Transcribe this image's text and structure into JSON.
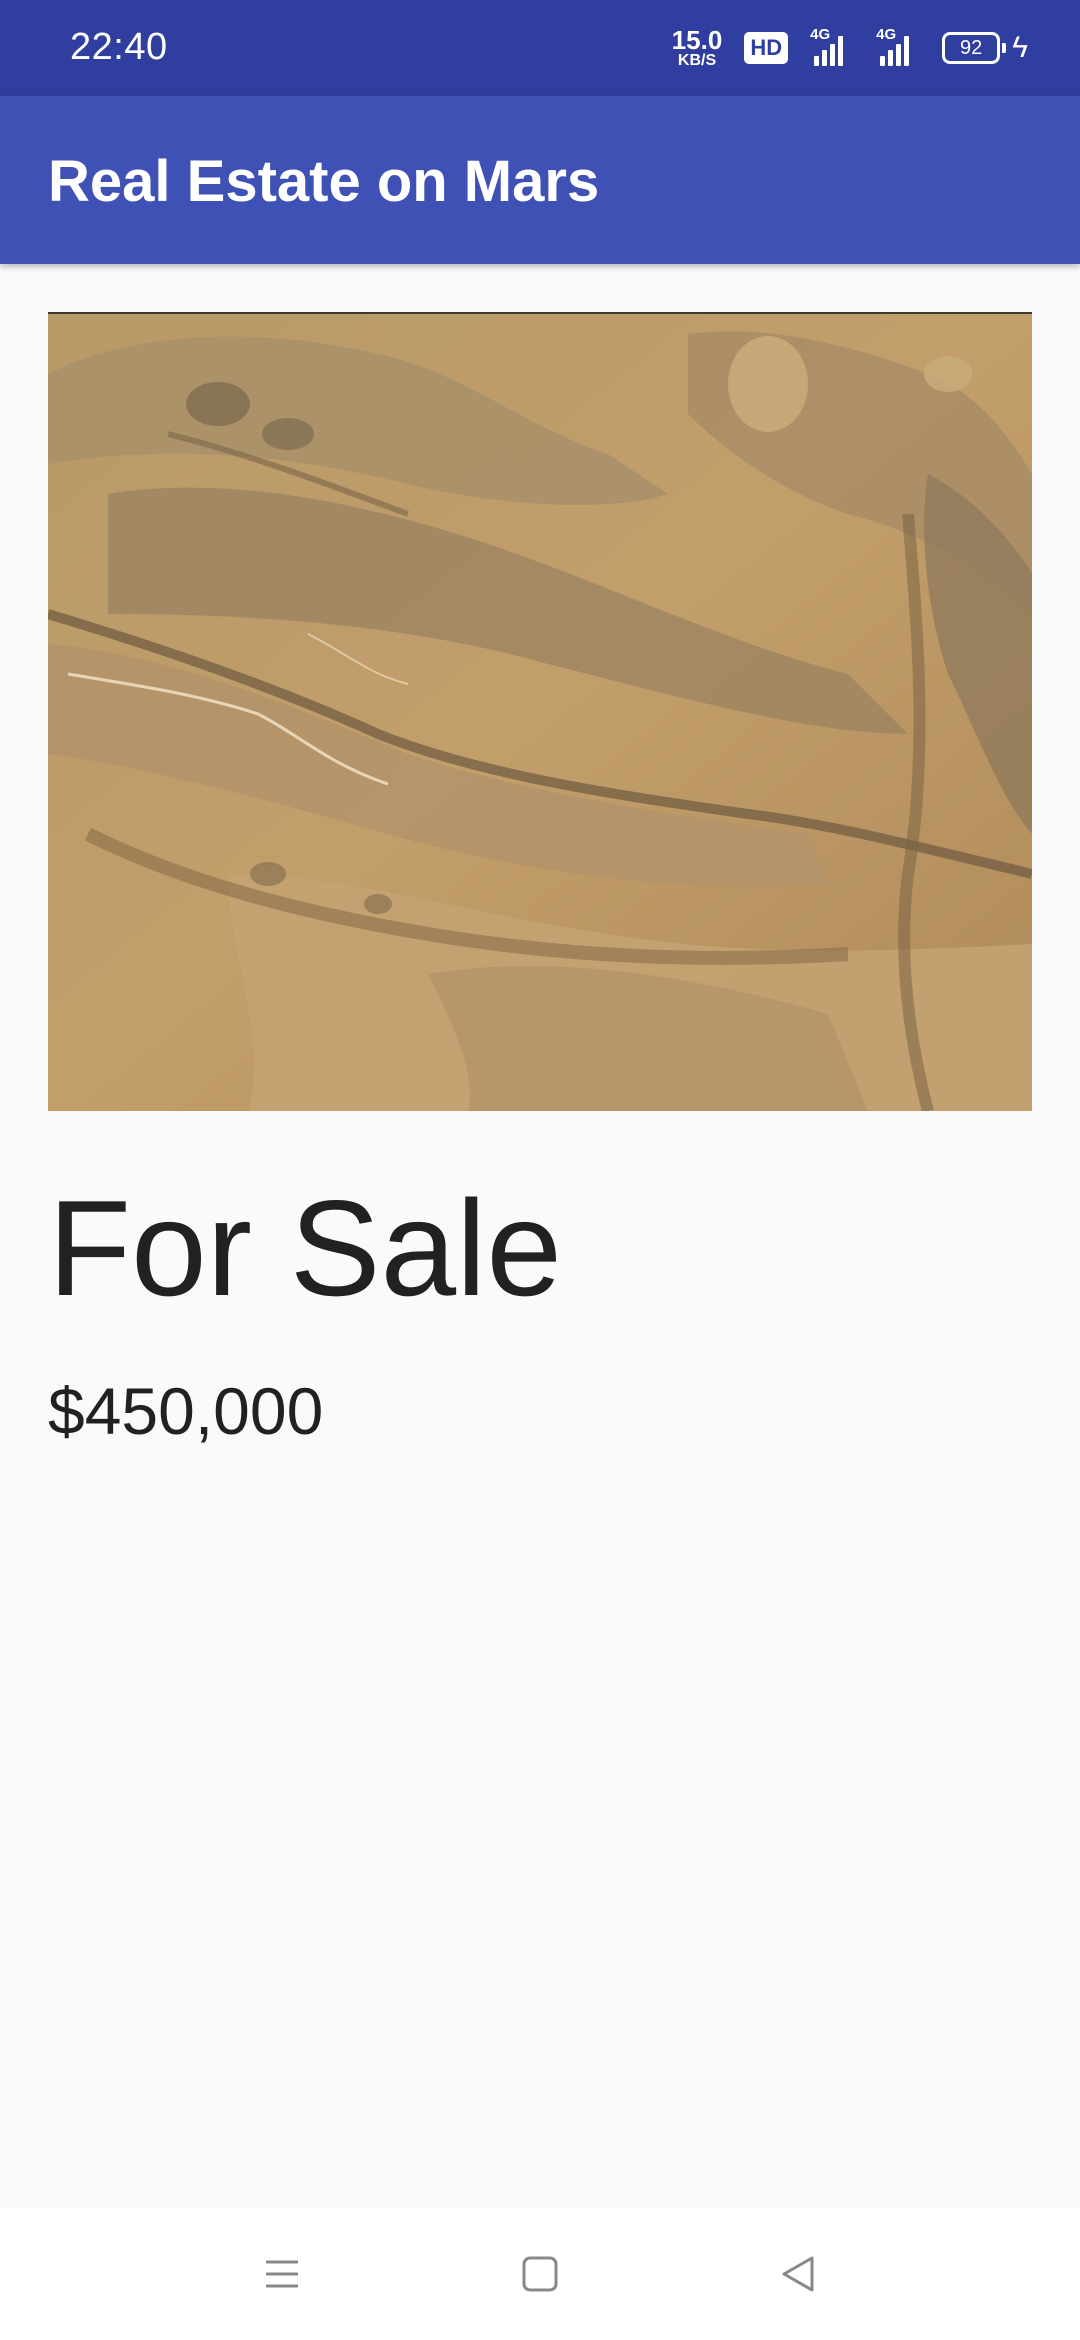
{
  "status": {
    "time": "22:40",
    "net_speed": "15.0",
    "net_unit": "KB/S",
    "hd": "HD",
    "signal1": "4G",
    "signal2": "4G",
    "battery": "92"
  },
  "app_bar": {
    "title": "Real Estate on Mars"
  },
  "listing": {
    "image_alt": "Mars surface photo",
    "type": "For Sale",
    "price": "$450,000"
  },
  "nav": {
    "menu_icon": "menu-icon",
    "home_icon": "home-icon",
    "back_icon": "back-icon"
  },
  "colors": {
    "status_bar": "#303f9f",
    "app_bar": "#3f51b5",
    "background": "#fafafa"
  }
}
